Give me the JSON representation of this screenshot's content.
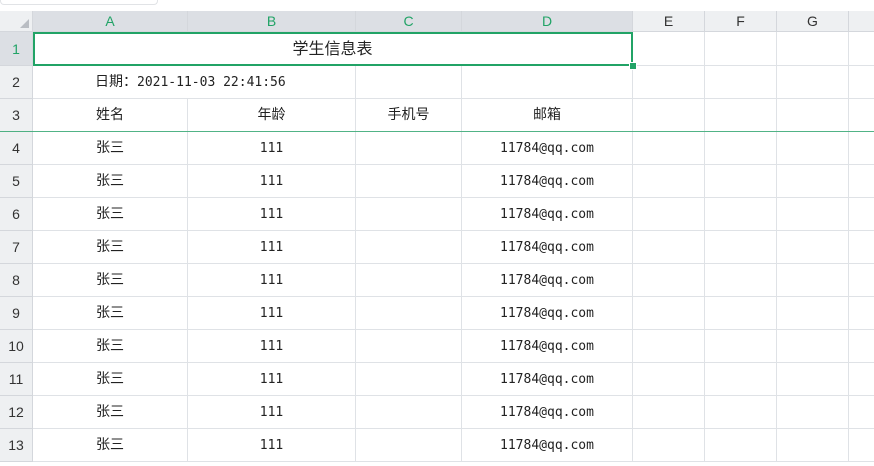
{
  "columns": [
    "A",
    "B",
    "C",
    "D",
    "E",
    "F",
    "G"
  ],
  "rows": [
    "1",
    "2",
    "3",
    "4",
    "5",
    "6",
    "7",
    "8",
    "9",
    "10",
    "11",
    "12",
    "13"
  ],
  "title": "学生信息表",
  "date_label": "日期：",
  "date_value": "2021-11-03 22:41:56",
  "headers": {
    "name": "姓名",
    "age": "年龄",
    "phone": "手机号",
    "email": "邮箱"
  },
  "records": [
    {
      "name": "张三",
      "age": "111",
      "phone": "",
      "email": "11784@qq.com"
    },
    {
      "name": "张三",
      "age": "111",
      "phone": "",
      "email": "11784@qq.com"
    },
    {
      "name": "张三",
      "age": "111",
      "phone": "",
      "email": "11784@qq.com"
    },
    {
      "name": "张三",
      "age": "111",
      "phone": "",
      "email": "11784@qq.com"
    },
    {
      "name": "张三",
      "age": "111",
      "phone": "",
      "email": "11784@qq.com"
    },
    {
      "name": "张三",
      "age": "111",
      "phone": "",
      "email": "11784@qq.com"
    },
    {
      "name": "张三",
      "age": "111",
      "phone": "",
      "email": "11784@qq.com"
    },
    {
      "name": "张三",
      "age": "111",
      "phone": "",
      "email": "11784@qq.com"
    },
    {
      "name": "张三",
      "age": "111",
      "phone": "",
      "email": "11784@qq.com"
    },
    {
      "name": "张三",
      "age": "111",
      "phone": "",
      "email": "11784@qq.com"
    }
  ],
  "selected_cell": "A1:D1",
  "accent_color": "#21a366"
}
